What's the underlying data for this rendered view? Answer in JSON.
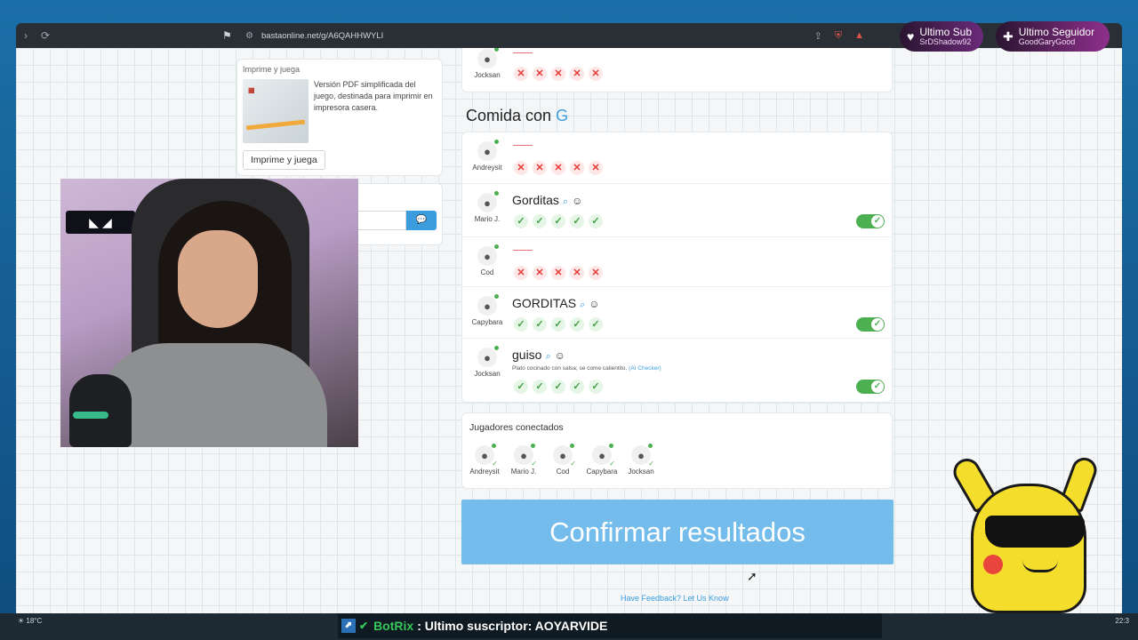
{
  "browser": {
    "url": "bastaonline.net/g/A6QAHHWYLI"
  },
  "promo": {
    "title": "Imprime y juega",
    "description": "Versión PDF simplificada del juego, destinada para imprimir en impresora casera.",
    "button": "Imprime y juega"
  },
  "section": {
    "title_prefix": "Comida con",
    "letter": "G"
  },
  "top_row": {
    "player": "Jocksan"
  },
  "rows": [
    {
      "player": "Andreysit",
      "answer": "",
      "hint": "",
      "votes": "x",
      "approved": false
    },
    {
      "player": "Mario J.",
      "answer": "Gorditas",
      "hint": "",
      "votes": "ok",
      "approved": true
    },
    {
      "player": "Cod",
      "answer": "",
      "hint": "",
      "votes": "x",
      "approved": false
    },
    {
      "player": "Capybara",
      "answer": "GORDITAS",
      "hint": "",
      "votes": "ok",
      "approved": true
    },
    {
      "player": "Jocksan",
      "answer": "guiso",
      "hint": "Plato cocinado con salsa; se come calientito.",
      "hint_link": "(AI Checker)",
      "votes": "ok",
      "approved": true
    }
  ],
  "players_card": {
    "title": "Jugadores conectados",
    "players": [
      "Andreysit",
      "Mario J.",
      "Cod",
      "Capybara",
      "Jocksan"
    ]
  },
  "confirm_button": "Confirmar resultados",
  "feedback_link": "Have Feedback? Let Us Know",
  "overlay": {
    "sub_title": "Ultimo Sub",
    "sub_name": "SrDShadow92",
    "follower_title": "Ultimo Seguidor",
    "follower_name": "GoodGaryGood",
    "ticker_brand": "BotRix",
    "ticker_text": ": Ultimo suscriptor: AOYARVIDE",
    "weather": "18°C",
    "clock": "22:3"
  },
  "colors": {
    "accent": "#3b9ddd",
    "confirm": "#74bcec",
    "approve": "#4caf50",
    "reject": "#e53935"
  }
}
